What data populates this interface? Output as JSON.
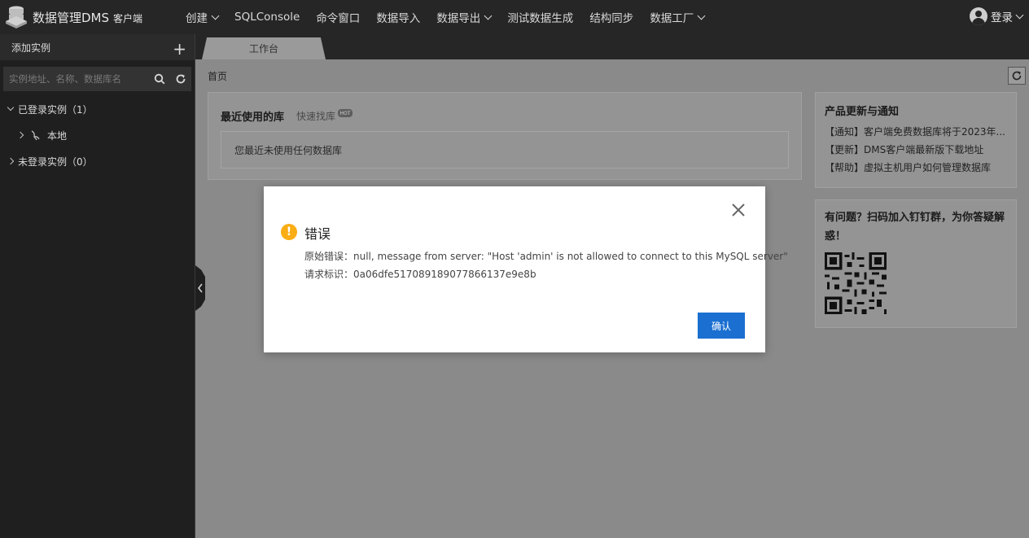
{
  "app": {
    "title": "数据管理DMS",
    "subtitle": "客户端"
  },
  "nav": {
    "items": [
      {
        "label": "创建",
        "dropdown": true
      },
      {
        "label": "SQLConsole",
        "dropdown": false
      },
      {
        "label": "命令窗口",
        "dropdown": false
      },
      {
        "label": "数据导入",
        "dropdown": false
      },
      {
        "label": "数据导出",
        "dropdown": true
      },
      {
        "label": "测试数据生成",
        "dropdown": false
      },
      {
        "label": "结构同步",
        "dropdown": false
      },
      {
        "label": "数据工厂",
        "dropdown": true
      }
    ],
    "login": "登录"
  },
  "sidebar": {
    "header": "添加实例",
    "search_placeholder": "实例地址、名称、数据库名",
    "groups": {
      "logged_in": "已登录实例（1）",
      "instance": "本地",
      "logged_out": "未登录实例（0）"
    }
  },
  "main": {
    "tab": "工作台",
    "breadcrumb": "首页",
    "recent": {
      "title": "最近使用的库",
      "quick_find": "快速找库",
      "badge": "HOT",
      "empty": "您最近未使用任何数据库"
    },
    "news": {
      "title": "产品更新与通知",
      "items": [
        "【通知】客户端免费数据库将于2023年...",
        "【更新】DMS客户端最新版下载地址",
        "【帮助】虚拟主机用户如何管理数据库"
      ]
    },
    "qr_text": "有问题？扫码加入钉钉群，为你答疑解惑！"
  },
  "dialog": {
    "title": "错误",
    "error_line": "原始错误：null, message from server: \"Host 'admin' is not allowed to connect to this MySQL server\"",
    "request_line": "请求标识：0a06dfe517089189077866137e9e8b",
    "confirm": "确认"
  },
  "colors": {
    "accent": "#1a6fd1",
    "warning": "#faad14",
    "topbar": "#262626"
  }
}
